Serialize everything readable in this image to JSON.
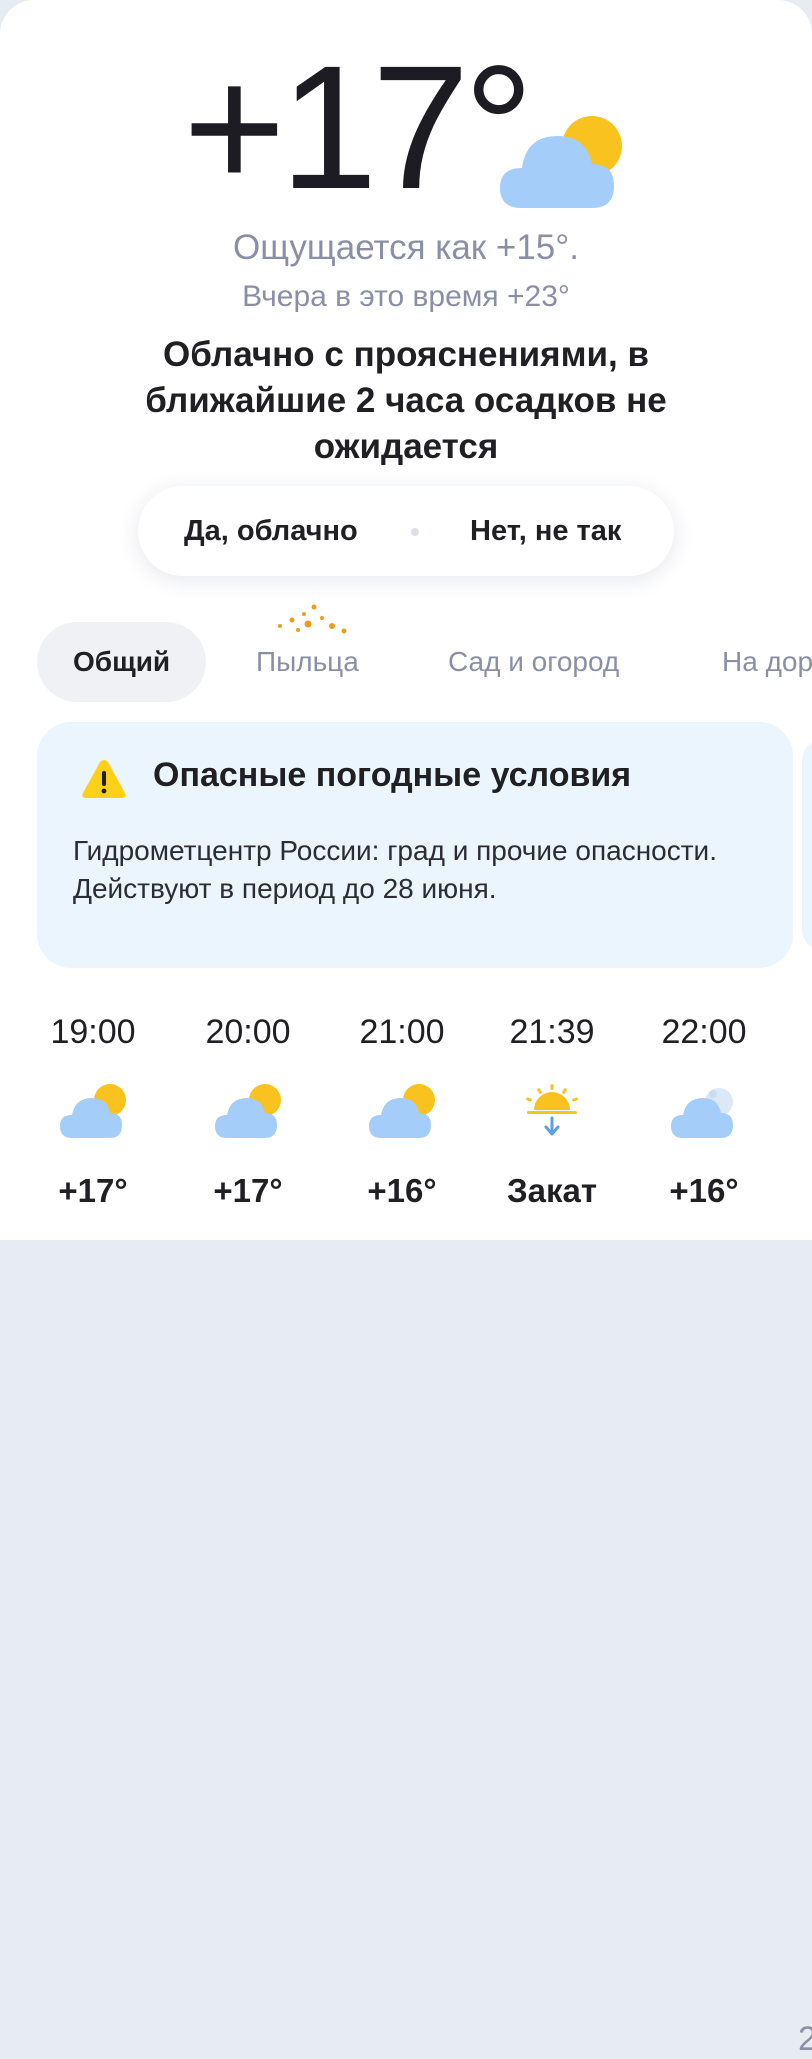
{
  "current": {
    "temperature": "+17°",
    "icon": "cloud-sun-icon",
    "feels_like": "Ощущается как +15°.",
    "yesterday": "Вчера в это время +23°",
    "condition": "Облачно с прояснениями, в ближайшие 2 часа осадков не ожидается"
  },
  "feedback": {
    "yes_label": "Да, облачно",
    "no_label": "Нет, не так"
  },
  "tabs": [
    {
      "label": "Общий",
      "active": true
    },
    {
      "label": "Пыльца",
      "active": false
    },
    {
      "label": "Сад и огород",
      "active": false
    },
    {
      "label": "На дороге",
      "active": false
    }
  ],
  "alert": {
    "icon": "warning-icon",
    "title": "Опасные погодные условия",
    "text": "Гидрометцентр России: град и прочие опасности. Действуют в период до 28 июня."
  },
  "hourly": [
    {
      "time": "19:00",
      "icon": "cloud-sun-icon",
      "temp": "+17°"
    },
    {
      "time": "20:00",
      "icon": "cloud-sun-icon",
      "temp": "+17°"
    },
    {
      "time": "21:00",
      "icon": "cloud-sun-icon",
      "temp": "+16°"
    },
    {
      "time": "21:39",
      "icon": "sunset-icon",
      "temp": "Закат"
    },
    {
      "time": "22:00",
      "icon": "cloud-moon-icon",
      "temp": "+16°"
    }
  ],
  "colors": {
    "sun": "#f9c21e",
    "cloud": "#a5cdfa",
    "alert_bg": "#eaf5fd",
    "warning": "#fdd118",
    "pollen": "#f29a1c",
    "muted_text": "#8a8fa6"
  }
}
